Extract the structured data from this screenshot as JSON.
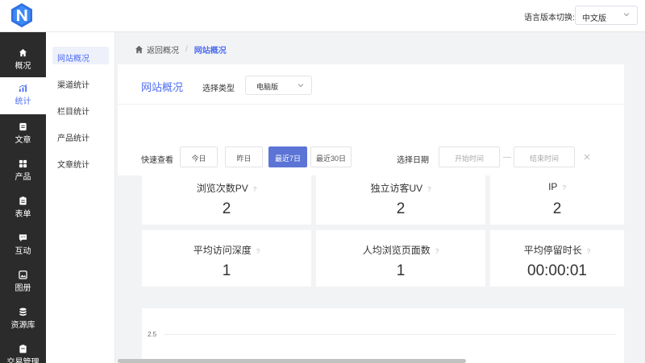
{
  "app": {
    "brand_color": "#4e6ef2",
    "language_label": "语言版本切换:",
    "language_value": "中文版"
  },
  "sidebar": {
    "items": [
      {
        "label": "概况",
        "icon": "home-icon"
      },
      {
        "label": "统计",
        "icon": "stats-icon",
        "active": true
      },
      {
        "label": "文章",
        "icon": "article-icon"
      },
      {
        "label": "产品",
        "icon": "product-icon"
      },
      {
        "label": "表单",
        "icon": "form-icon"
      },
      {
        "label": "互动",
        "icon": "chat-icon"
      },
      {
        "label": "图册",
        "icon": "gallery-icon"
      },
      {
        "label": "资源库",
        "icon": "database-icon"
      },
      {
        "label": "交易管理",
        "icon": "trade-icon"
      }
    ]
  },
  "subnav": {
    "items": [
      {
        "label": "网站概况",
        "active": true
      },
      {
        "label": "渠道统计"
      },
      {
        "label": "栏目统计"
      },
      {
        "label": "产品统计"
      },
      {
        "label": "文章统计"
      }
    ]
  },
  "breadcrumb": {
    "back": "返回概况",
    "separator": "/",
    "current": "网站概况"
  },
  "filter": {
    "title": "网站概况",
    "type_label": "选择类型",
    "type_value": "电脑版",
    "quick_label": "快速查看",
    "quick_buttons": [
      "今日",
      "昨日",
      "最近7日",
      "最近30日"
    ],
    "active_quick": "最近7日",
    "date_label": "选择日期",
    "start_placeholder": "开始时间",
    "dash": "—",
    "end_placeholder": "结束时间"
  },
  "stats": [
    {
      "name": "浏览次数PV",
      "value": "2"
    },
    {
      "name": "独立访客UV",
      "value": "2"
    },
    {
      "name": "IP",
      "value": "2"
    },
    {
      "name": "平均访问深度",
      "value": "1"
    },
    {
      "name": "人均浏览页面数",
      "value": "1"
    },
    {
      "name": "平均停留时长",
      "value": "00:00:01"
    }
  ],
  "stats_help": "?",
  "chart": {
    "tick_label": "2.5"
  }
}
